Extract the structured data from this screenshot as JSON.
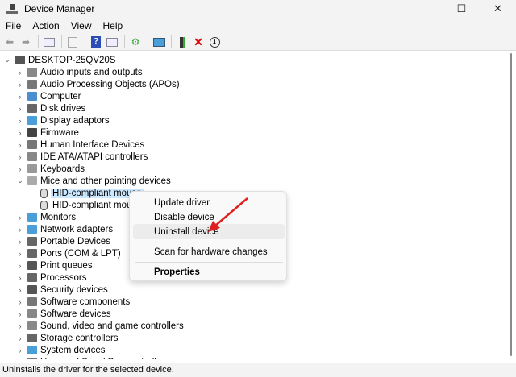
{
  "window": {
    "title": "Device Manager",
    "controls": [
      "—",
      "☐",
      "✕"
    ]
  },
  "menu": [
    "File",
    "Action",
    "View",
    "Help"
  ],
  "toolbar": [
    "back",
    "forward",
    "show-hide-console-tree",
    "properties",
    "help",
    "show-action-pane",
    "scan-hardware",
    "monitor",
    "update-driver",
    "uninstall",
    "disable"
  ],
  "tree": {
    "root": "DESKTOP-25QV20S",
    "categories": [
      "Audio inputs and outputs",
      "Audio Processing Objects (APOs)",
      "Computer",
      "Disk drives",
      "Display adaptors",
      "Firmware",
      "Human Interface Devices",
      "IDE ATA/ATAPI controllers",
      "Keyboards",
      "Mice and other pointing devices",
      "Monitors",
      "Network adapters",
      "Portable Devices",
      "Ports (COM & LPT)",
      "Print queues",
      "Processors",
      "Security devices",
      "Software components",
      "Software devices",
      "Sound, video and game controllers",
      "Storage controllers",
      "System devices",
      "Universal Serial Bus controllers"
    ],
    "expanded_index": 9,
    "children": [
      "HID-compliant mouse",
      "HID-compliant mouse"
    ]
  },
  "context_menu": {
    "items": [
      "Update driver",
      "Disable device",
      "Uninstall device",
      "Scan for hardware changes",
      "Properties"
    ],
    "highlighted": "Uninstall device"
  },
  "status": "Uninstalls the driver for the selected device.",
  "colors": {
    "arrow": "#e02020",
    "selection": "#cce8ff"
  }
}
